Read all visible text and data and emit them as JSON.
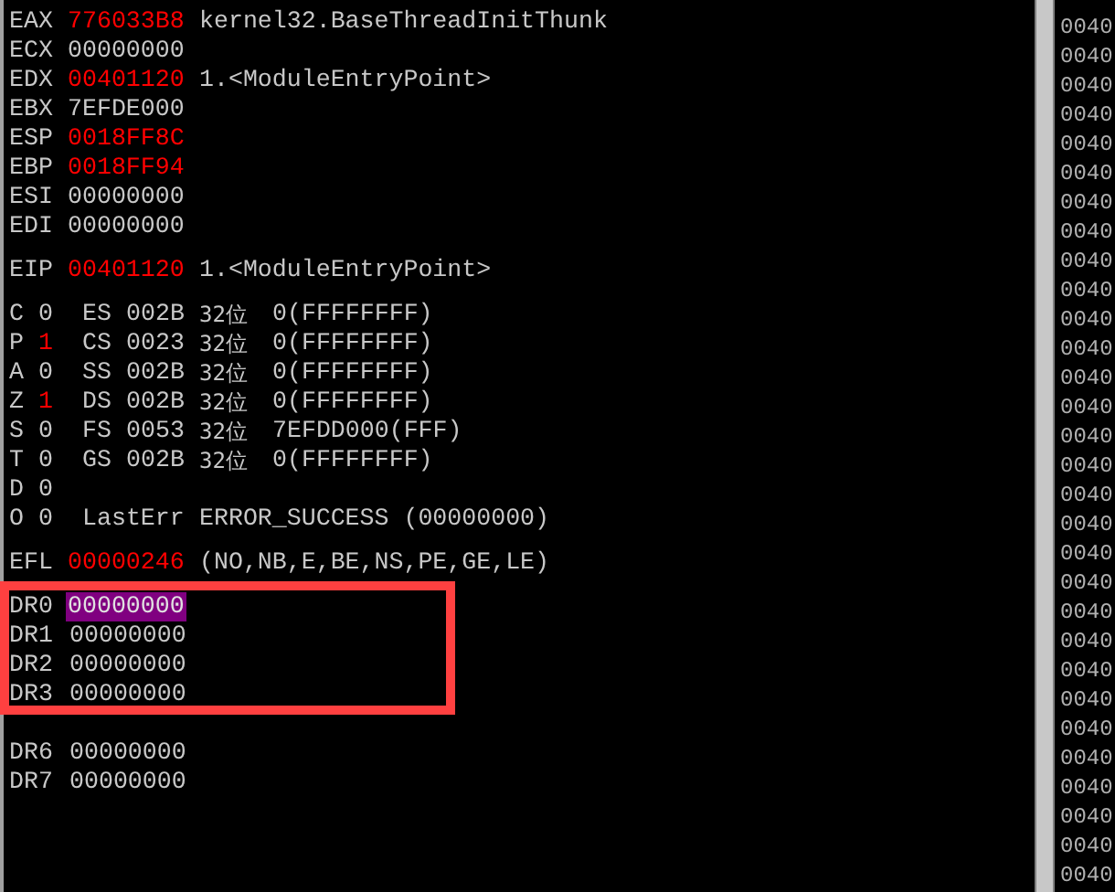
{
  "general_registers": [
    {
      "name": "EAX",
      "value": "776033B8",
      "changed": true,
      "comment": "kernel32.BaseThreadInitThunk"
    },
    {
      "name": "ECX",
      "value": "00000000",
      "changed": false
    },
    {
      "name": "EDX",
      "value": "00401120",
      "changed": true,
      "comment": "1.<ModuleEntryPoint>"
    },
    {
      "name": "EBX",
      "value": "7EFDE000",
      "changed": false
    },
    {
      "name": "ESP",
      "value": "0018FF8C",
      "changed": true
    },
    {
      "name": "EBP",
      "value": "0018FF94",
      "changed": true
    },
    {
      "name": "ESI",
      "value": "00000000",
      "changed": false
    },
    {
      "name": "EDI",
      "value": "00000000",
      "changed": false
    }
  ],
  "eip": {
    "name": "EIP",
    "value": "00401120",
    "changed": true,
    "comment": "1.<ModuleEntryPoint>"
  },
  "flags": [
    {
      "kind": "segment",
      "flag": "C",
      "bit": "0",
      "changed": false,
      "segment": "ES",
      "selector": "002B",
      "bits": "32位",
      "base": "0(FFFFFFFF)"
    },
    {
      "kind": "segment",
      "flag": "P",
      "bit": "1",
      "changed": true,
      "segment": "CS",
      "selector": "0023",
      "bits": "32位",
      "base": "0(FFFFFFFF)"
    },
    {
      "kind": "segment",
      "flag": "A",
      "bit": "0",
      "changed": false,
      "segment": "SS",
      "selector": "002B",
      "bits": "32位",
      "base": "0(FFFFFFFF)"
    },
    {
      "kind": "segment",
      "flag": "Z",
      "bit": "1",
      "changed": true,
      "segment": "DS",
      "selector": "002B",
      "bits": "32位",
      "base": "0(FFFFFFFF)"
    },
    {
      "kind": "segment",
      "flag": "S",
      "bit": "0",
      "changed": false,
      "segment": "FS",
      "selector": "0053",
      "bits": "32位",
      "base": "7EFDD000(FFF)"
    },
    {
      "kind": "segment",
      "flag": "T",
      "bit": "0",
      "changed": false,
      "segment": "GS",
      "selector": "002B",
      "bits": "32位",
      "base": "0(FFFFFFFF)"
    },
    {
      "kind": "plain",
      "flag": "D",
      "bit": "0",
      "changed": false
    },
    {
      "kind": "lasterr",
      "flag": "O",
      "bit": "0",
      "changed": false,
      "label": "LastErr",
      "error": "ERROR_SUCCESS (00000000)"
    }
  ],
  "efl": {
    "name": "EFL",
    "value": "00000246",
    "changed": true,
    "comment": "(NO,NB,E,BE,NS,PE,GE,LE)"
  },
  "debug_register_groups": [
    {
      "highlighted": true,
      "rows": [
        {
          "name": "DR0",
          "value": "00000000",
          "selected": true
        },
        {
          "name": "DR1",
          "value": "00000000",
          "selected": false
        },
        {
          "name": "DR2",
          "value": "00000000",
          "selected": false
        },
        {
          "name": "DR3",
          "value": "00000000",
          "selected": false
        }
      ]
    },
    {
      "highlighted": false,
      "rows": [
        {
          "name": "DR6",
          "value": "00000000",
          "selected": false
        },
        {
          "name": "DR7",
          "value": "00000000",
          "selected": false
        }
      ]
    }
  ],
  "memory_addresses": [
    "0040",
    "0040",
    "0040",
    "0040",
    "0040",
    "0040",
    "0040",
    "0040",
    "0040",
    "0040",
    "0040",
    "0040",
    "0040",
    "0040",
    "0040",
    "0040",
    "0040",
    "0040",
    "0040",
    "0040",
    "0040",
    "0040",
    "0040",
    "0040",
    "0040",
    "0040",
    "0040",
    "0040",
    "0040",
    "0040"
  ]
}
